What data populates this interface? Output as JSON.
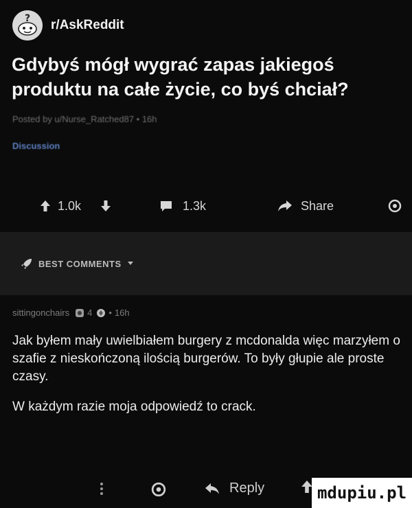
{
  "post": {
    "subreddit": "r/AskReddit",
    "title": "Gdybyś mógł wygrać zapas jakiegoś produktu na całe życie, co byś chciał?",
    "meta": "Posted by u/Nurse_Ratched87 • 16h",
    "flair": "Discussion"
  },
  "actions": {
    "upvotes": "1.0k",
    "comments": "1.3k",
    "share": "Share"
  },
  "sort": {
    "label": "BEST COMMENTS"
  },
  "comment": {
    "author": "sittingonchairs",
    "award_count": "4",
    "age": "16h",
    "paragraphs": [
      "Jak byłem mały uwielbiałem burgery z mcdonalda więc marzyłem o szafie z nieskończoną ilością burgerów. To były głupie ale proste czasy.",
      "W każdym razie moja odpowiedź to crack."
    ],
    "reply_label": "Reply"
  },
  "watermark": "mdupiu.pl"
}
